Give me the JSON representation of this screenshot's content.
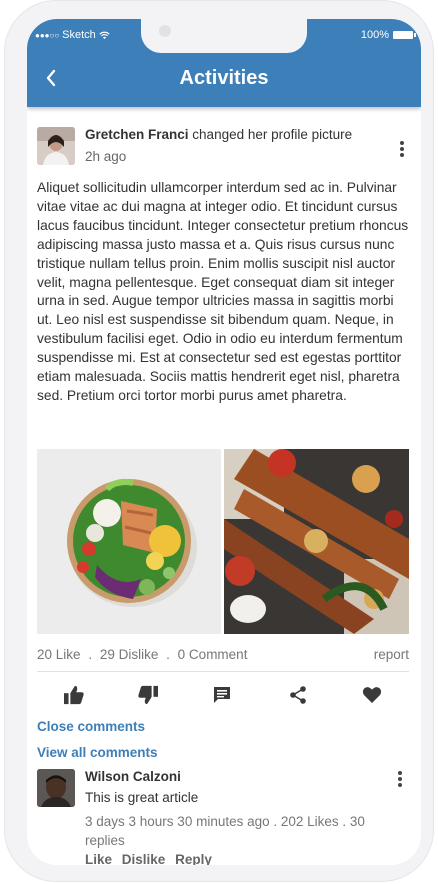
{
  "statusbar": {
    "carrier": "Sketch",
    "battery": "100%"
  },
  "header": {
    "title": "Activities"
  },
  "post": {
    "author": "Gretchen Franci",
    "action": "changed her profile picture",
    "time": "2h ago",
    "text": "Aliquet sollicitudin ullamcorper interdum sed ac in. Pulvinar vitae vitae ac dui magna at integer odio. Et tincidunt cursus lacus faucibus tincidunt. Integer consectetur pretium rhoncus adipiscing massa justo massa et a. Quis risus cursus nunc tristique nullam tellus proin. Enim mollis suscipit nisl auctor velit, magna pellentesque. Eget consequat diam sit integer urna in sed. Augue tempor ultricies massa in sagittis morbi ut. Leo nisl est suspendisse sit bibendum quam. Neque, in vestibulum facilisi eget. Odio in odio eu interdum fermentum suspendisse mi. Est at consectetur sed est egestas porttitor etiam malesuada. Sociis mattis hendrerit eget nisl, pharetra sed. Pretium orci tortor morbi purus amet pharetra.",
    "stats": {
      "likes": "20 Like",
      "dislikes": "29 Dislike",
      "comments": "0 Comment",
      "separator": ".",
      "report": "report"
    }
  },
  "actions": [
    "like-icon",
    "dislike-icon",
    "comment-icon",
    "share-icon",
    "heart-icon"
  ],
  "links": {
    "close_comments": "Close comments",
    "view_all": "View all comments"
  },
  "comment": {
    "author": "Wilson Calzoni",
    "text": "This is great article",
    "meta": "3 days 3 hours 30 minutes ago . 202 Likes . 30 replies",
    "like": "Like",
    "dislike": "Dislike",
    "reply": "Reply"
  },
  "colors": {
    "accent": "#3d7fb8",
    "icon": "#3a3a3a",
    "text": "#333333",
    "muted": "#777777"
  }
}
